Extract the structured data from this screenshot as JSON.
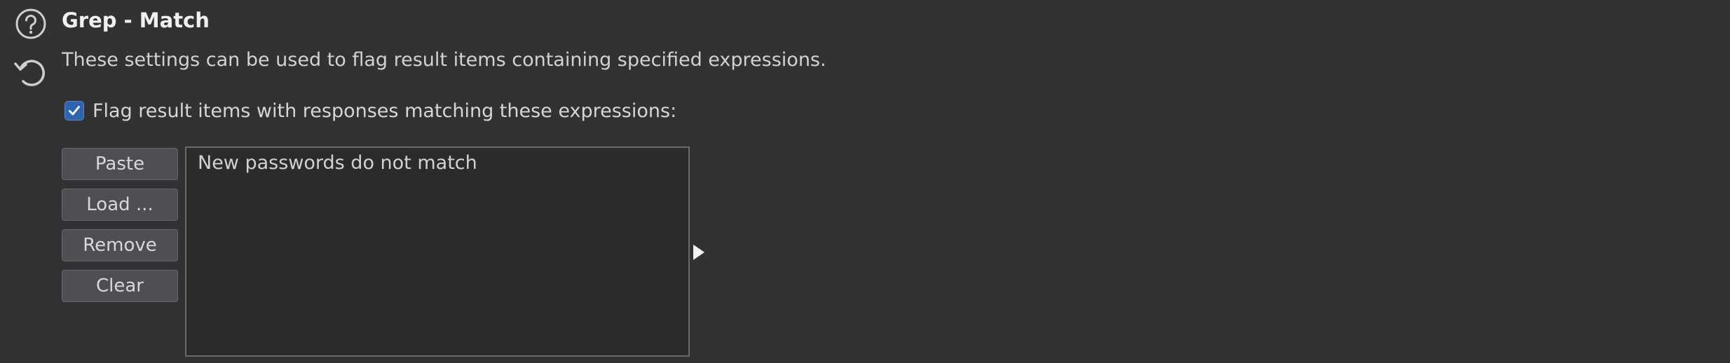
{
  "panel": {
    "title": "Grep - Match",
    "description": "These settings can be used to flag result items containing specified expressions.",
    "icons": {
      "help": "help-circle-icon",
      "reset": "reset-icon"
    }
  },
  "flag_option": {
    "checked": true,
    "label": "Flag result items with responses matching these expressions:"
  },
  "buttons": {
    "paste": "Paste",
    "load": "Load ...",
    "remove": "Remove",
    "clear": "Clear"
  },
  "expressions": [
    "New passwords do not match"
  ],
  "colors": {
    "background": "#323234",
    "checkbox_accent": "#2f65ad",
    "listbox_background": "#2b2b2b"
  }
}
